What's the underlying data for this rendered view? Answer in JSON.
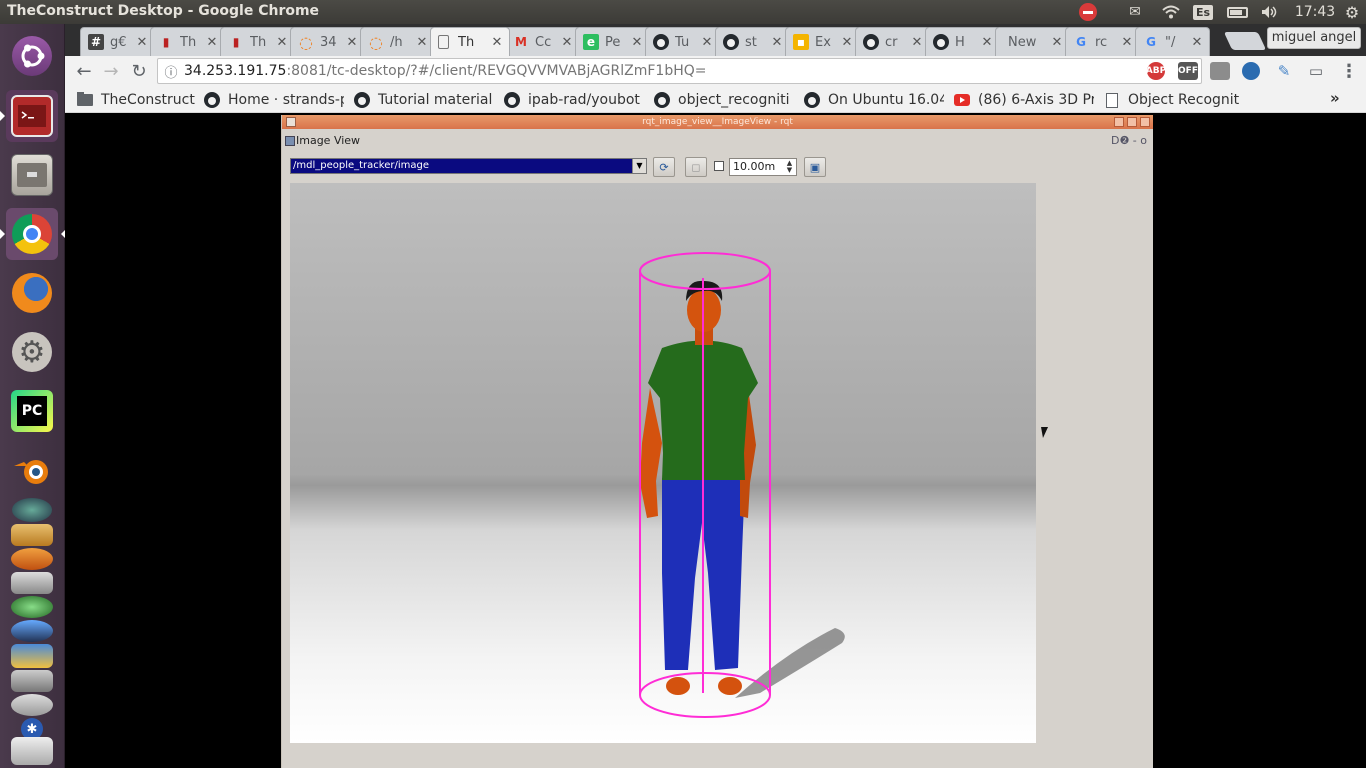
{
  "window_title": "TheConstruct Desktop - Google Chrome",
  "panel": {
    "keyboard_layout": "Es",
    "clock": "17:43",
    "indicators": [
      "stop-icon",
      "mail-icon",
      "wifi-icon",
      "keyboard-icon",
      "battery-icon",
      "volume-icon",
      "gear-icon"
    ]
  },
  "launcher": {
    "items": [
      "ubuntu-dash",
      "terminal",
      "file-manager",
      "chrome",
      "firefox",
      "system-settings",
      "pycharm",
      "blender",
      "app-1",
      "app-2",
      "app-3",
      "app-4",
      "app-5",
      "app-6",
      "app-7",
      "app-8",
      "app-9",
      "app-10"
    ]
  },
  "tabs": [
    {
      "icon": "#",
      "title": "g€",
      "active": false
    },
    {
      "icon": "doc",
      "title": "Th",
      "active": false
    },
    {
      "icon": "doc",
      "title": "Th",
      "active": false
    },
    {
      "icon": "arc",
      "title": "34",
      "active": false
    },
    {
      "icon": "arc",
      "title": "/h",
      "active": false
    },
    {
      "icon": "page",
      "title": "Th",
      "active": true
    },
    {
      "icon": "M",
      "title": "Cc",
      "active": false
    },
    {
      "icon": "ev",
      "title": "Pe",
      "active": false
    },
    {
      "icon": "gh",
      "title": "Tu",
      "active": false
    },
    {
      "icon": "gh",
      "title": "st",
      "active": false
    },
    {
      "icon": "box",
      "title": "Ex",
      "active": false
    },
    {
      "icon": "gh",
      "title": "cr",
      "active": false
    },
    {
      "icon": "gh",
      "title": "H",
      "active": false
    },
    {
      "icon": "",
      "title": "New",
      "active": false
    },
    {
      "icon": "G",
      "title": "rc",
      "active": false
    },
    {
      "icon": "G",
      "title": "\"/",
      "active": false
    }
  ],
  "profile_name": "miguel angel",
  "address": {
    "host": "34.253.191.75",
    "rest": ":8081/tc-desktop/?#/client/REVGQVVMVABjAGRlZmF1bHQ="
  },
  "extensions": [
    "ABP",
    "OFF"
  ],
  "bookmarks": [
    {
      "icon": "folder",
      "label": "TheConstruct"
    },
    {
      "icon": "gh",
      "label": "Home · strands-p"
    },
    {
      "icon": "gh",
      "label": "Tutorial material"
    },
    {
      "icon": "gh",
      "label": "ipab-rad/youbot"
    },
    {
      "icon": "gh",
      "label": "object_recogniti"
    },
    {
      "icon": "gh",
      "label": "On Ubuntu 16.04"
    },
    {
      "icon": "yt",
      "label": "(86) 6-Axis 3D Pr"
    },
    {
      "icon": "doc",
      "label": "Object Recognit"
    }
  ],
  "bookmarks_more": "»",
  "rqt": {
    "title": "rqt_image_view__ImageView - rqt",
    "plugin_title": "Image View",
    "plugin_controls": "D❷ - o",
    "topic": "/mdl_people_tracker/image",
    "timeout": "10.00m"
  }
}
